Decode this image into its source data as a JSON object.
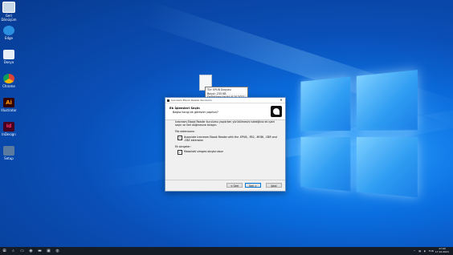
{
  "desktop_icons": [
    {
      "label": "Geri Dönüşüm",
      "icon": "recycle-bin-icon"
    },
    {
      "label": "Edge",
      "icon": "edge-icon"
    },
    {
      "label": "Dosya",
      "icon": "file-icon"
    },
    {
      "label": "Chrome",
      "icon": "chrome-icon"
    },
    {
      "label": "Illustrator",
      "icon": "illustrator-icon",
      "glyph": "Ai"
    },
    {
      "label": "InDesign",
      "icon": "indesign-icon",
      "glyph": "Id"
    },
    {
      "label": "Setup",
      "icon": "setup-icon"
    }
  ],
  "tooltip": {
    "line1": "Tür: EPUB Dosyası",
    "line2": "Boyut: 235 KB",
    "line3": "Değiştirme tarihi: 6.10.2021 00:47"
  },
  "dialog": {
    "window_title": "Icecream Ebook Reader Kurulumu",
    "heading": "Ek İşlemleri Seçin",
    "subheading": "Başka hangi ek görevler yapılsın?",
    "description": "Icecream Ebook Reader kurulumu yapılırken yürütülmesini istediğiniz ek işleri seçin ve İleri düğmesine tıklayın.",
    "file_assoc_label": "File extensions:",
    "checkbox1": "Associate Icecream Ebook Reader with the .EPUB, .FB2, .MOBI, .CBR and .CBZ extension",
    "extra_label": "Ek simgeler:",
    "checkbox2": "Masaüstü simgesi oluşturulsun",
    "back": "< Geri",
    "next": "İleri >",
    "cancel": "İptal"
  },
  "taskbar": {
    "time": "17:00",
    "date": "17.10.2021",
    "lang": "TUR"
  }
}
